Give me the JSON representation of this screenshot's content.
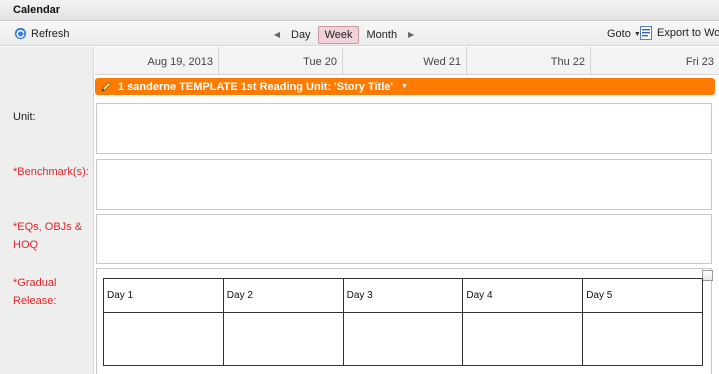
{
  "window": {
    "title": "Calendar"
  },
  "toolbar": {
    "refresh_label": "Refresh",
    "views": [
      {
        "label": "Day",
        "active": false
      },
      {
        "label": "Week",
        "active": true
      },
      {
        "label": "Month",
        "active": false
      }
    ],
    "goto_label": "Goto",
    "export_label": "Export to Word"
  },
  "calendar": {
    "day_headers": [
      "Aug 19, 2013",
      "Tue 20",
      "Wed 21",
      "Thu 22",
      "Fri 23"
    ],
    "event": {
      "label": "1 sanderne TEMPLATE 1st Reading Unit: 'Story Title'",
      "color": "#ff7a00"
    }
  },
  "form": {
    "rows": [
      {
        "label": "Unit:",
        "color": "#222222"
      },
      {
        "label": "*Benchmark(s):",
        "color": "#e0262a"
      },
      {
        "label": "*EQs, OBJs & HOQ",
        "color": "#e0262a"
      },
      {
        "label": "*Gradual Release:",
        "color": "#e0262a"
      }
    ],
    "gradual_release_days": [
      "Day 1",
      "Day 2",
      "Day 3",
      "Day 4",
      "Day 5"
    ]
  },
  "colors": {
    "active_view": "#f0d2d8",
    "required_label": "#e0262a"
  }
}
